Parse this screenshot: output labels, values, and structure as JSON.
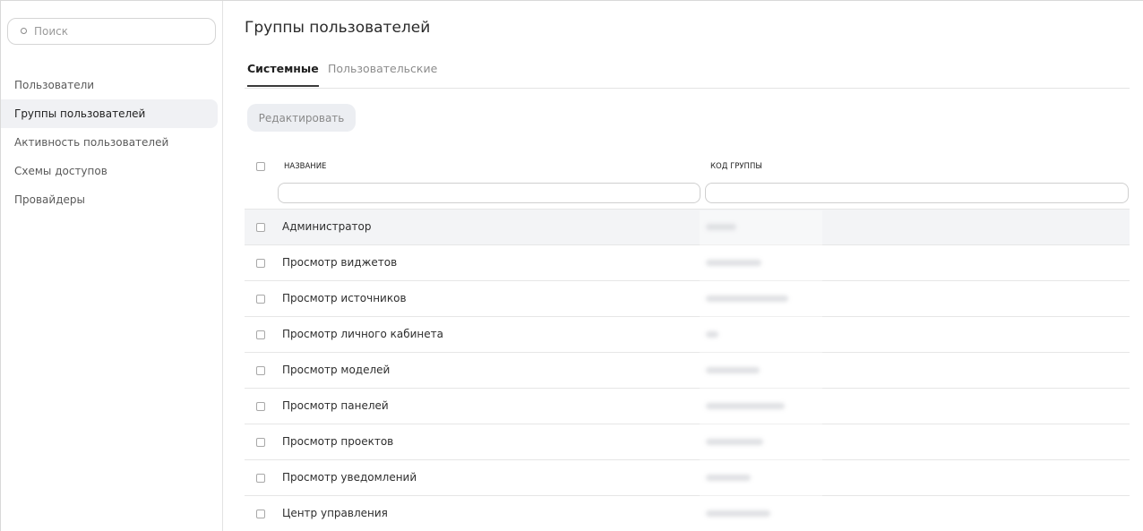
{
  "sidebar": {
    "search": {
      "placeholder": "Поиск"
    },
    "items": [
      {
        "label": "Пользователи",
        "active": false
      },
      {
        "label": "Группы пользователей",
        "active": true
      },
      {
        "label": "Активность пользователей",
        "active": false
      },
      {
        "label": "Схемы доступов",
        "active": false
      },
      {
        "label": "Провайдеры",
        "active": false
      }
    ]
  },
  "main": {
    "title": "Группы пользователей",
    "tabs": [
      {
        "label": "Системные",
        "active": true
      },
      {
        "label": "Пользовательские",
        "active": false
      }
    ],
    "edit_button": "Редактировать",
    "table": {
      "columns": {
        "name": "НАЗВАНИЕ",
        "code": "КОД ГРУППЫ"
      },
      "rows": [
        {
          "name": "Администратор",
          "code_redacted": true
        },
        {
          "name": "Просмотр виджетов",
          "code_redacted": true
        },
        {
          "name": "Просмотр источников",
          "code_redacted": true
        },
        {
          "name": "Просмотр личного кабинета",
          "code_redacted": true
        },
        {
          "name": "Просмотр моделей",
          "code_redacted": true
        },
        {
          "name": "Просмотр панелей",
          "code_redacted": true
        },
        {
          "name": "Просмотр проектов",
          "code_redacted": true
        },
        {
          "name": "Просмотр уведомлений",
          "code_redacted": true
        },
        {
          "name": "Центр управления",
          "code_redacted": true
        }
      ]
    }
  },
  "colors": {
    "active_nav_bg": "#f0f1f4",
    "button_bg": "#eceef2",
    "tab_underline": "#3a3a3a",
    "row_hover_bg": "#f3f4f6"
  }
}
